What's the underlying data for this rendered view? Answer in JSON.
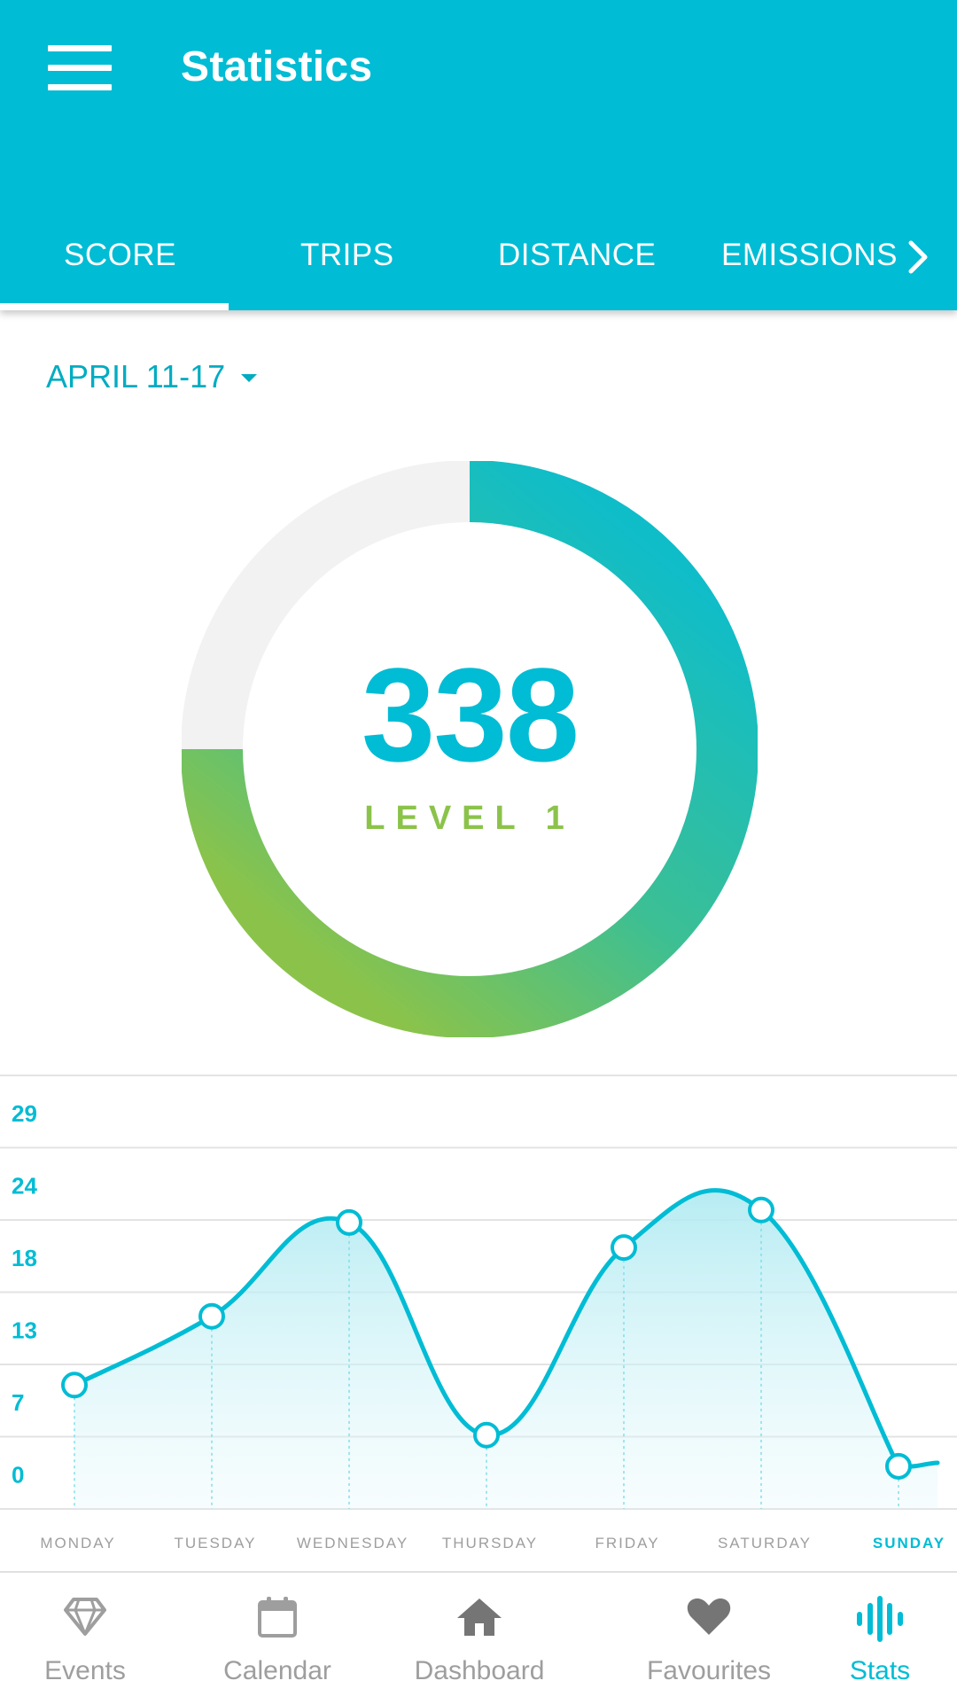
{
  "app_bar": {
    "title": "Statistics",
    "menu_icon": "hamburger-menu-icon"
  },
  "tabs": [
    {
      "label": "SCORE",
      "selected": true
    },
    {
      "label": "TRIPS",
      "selected": false
    },
    {
      "label": "DISTANCE",
      "selected": false
    },
    {
      "label": "EMISSIONS",
      "selected": false
    }
  ],
  "date_range": {
    "label": "APRIL 11-17"
  },
  "score": {
    "value": "338",
    "level_label": "LEVEL 1",
    "progress_fraction": 0.75
  },
  "colors": {
    "primary": "#00BCD4",
    "accent_green": "#8BC34A",
    "teal": "#26B6A8",
    "track": "#F2F2F2",
    "inactive": "#9E9E9E"
  },
  "chart_data": {
    "type": "line",
    "categories": [
      "MONDAY",
      "TUESDAY",
      "WEDNESDAY",
      "THURSDAY",
      "FRIDAY",
      "SATURDAY",
      "SUNDAY"
    ],
    "values": [
      7,
      12.5,
      20,
      3,
      18,
      21,
      0.5
    ],
    "y_ticks": [
      "29",
      "24",
      "18",
      "13",
      "7",
      "0"
    ],
    "highlighted_category": "SUNDAY",
    "ylim": [
      0,
      29
    ],
    "grid": true,
    "fill": true
  },
  "bottom_nav": [
    {
      "label": "Events",
      "icon": "diamond-icon",
      "active": false
    },
    {
      "label": "Calendar",
      "icon": "calendar-icon",
      "active": false
    },
    {
      "label": "Dashboard",
      "icon": "home-icon",
      "active": false
    },
    {
      "label": "Favourites",
      "icon": "heart-icon",
      "active": false
    },
    {
      "label": "Stats",
      "icon": "stats-bars-icon",
      "active": true
    }
  ]
}
